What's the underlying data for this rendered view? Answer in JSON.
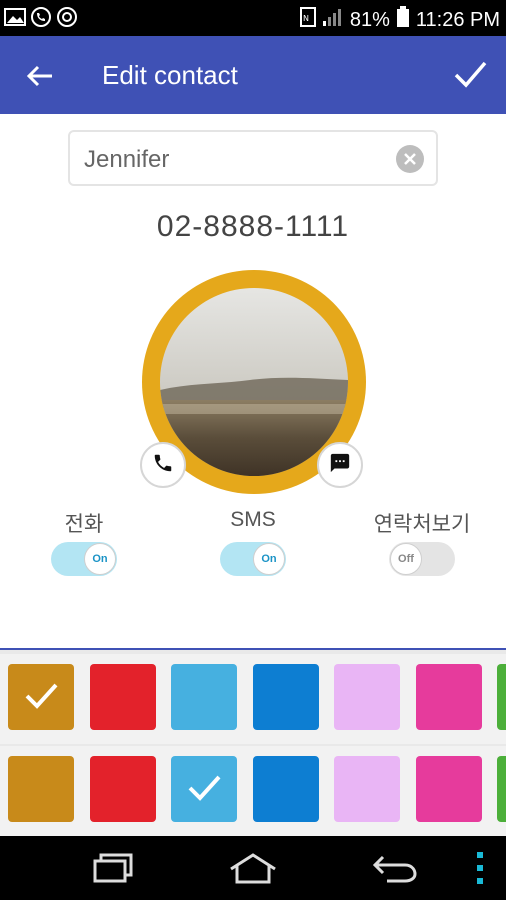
{
  "status_bar": {
    "battery": "81%",
    "time": "11:26 PM",
    "left_icons": [
      "image-icon",
      "whatsapp-icon",
      "sync-icon"
    ],
    "right_icons": [
      "nfc-icon",
      "signal-icon",
      "battery-icon"
    ]
  },
  "app_bar": {
    "title": "Edit contact",
    "back_icon": "arrow-back-icon",
    "save_icon": "check-icon",
    "background": "#3f51b5"
  },
  "name_field": {
    "value": "Jennifer",
    "clear_icon": "clear-icon"
  },
  "phone_number": "02-8888-1111",
  "avatar": {
    "ring_color": "#e5a81b",
    "call_icon": "phone-icon",
    "message_icon": "message-icon"
  },
  "toggles": [
    {
      "label": "전화",
      "state": "On",
      "on": true
    },
    {
      "label": "SMS",
      "state": "On",
      "on": true
    },
    {
      "label": "연락처보기",
      "state": "Off",
      "on": false
    }
  ],
  "palette": {
    "row1": [
      {
        "color": "#c88a1a",
        "selected": true
      },
      {
        "color": "#e3222b",
        "selected": false
      },
      {
        "color": "#46b0e0",
        "selected": false
      },
      {
        "color": "#0d7ed2",
        "selected": false
      },
      {
        "color": "#e9b5f5",
        "selected": false
      },
      {
        "color": "#e63b9c",
        "selected": false
      },
      {
        "color": "#4caf3a",
        "selected": false
      }
    ],
    "row2": [
      {
        "color": "#c88a1a",
        "selected": false
      },
      {
        "color": "#e3222b",
        "selected": false
      },
      {
        "color": "#46b0e0",
        "selected": true
      },
      {
        "color": "#0d7ed2",
        "selected": false
      },
      {
        "color": "#e9b5f5",
        "selected": false
      },
      {
        "color": "#e63b9c",
        "selected": false
      },
      {
        "color": "#4caf3a",
        "selected": false
      }
    ]
  },
  "nav_bar": {
    "icons": [
      "recent-apps-icon",
      "home-icon",
      "back-icon",
      "menu-icon"
    ]
  }
}
